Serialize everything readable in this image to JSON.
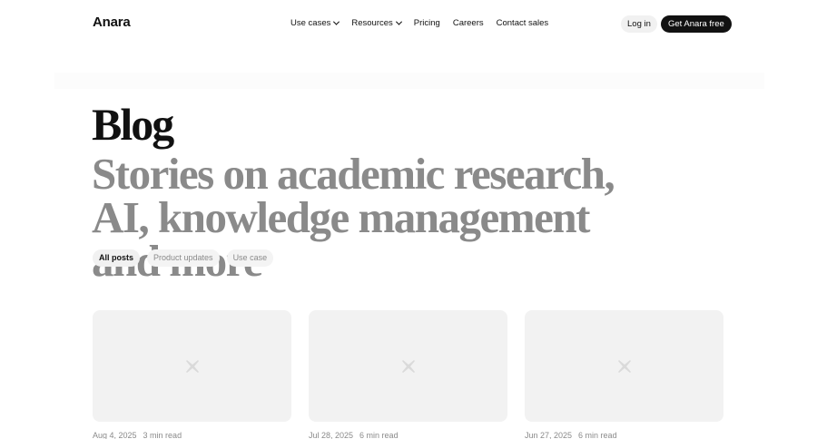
{
  "nav": {
    "logo": "Anara",
    "links": [
      {
        "label": "Use cases",
        "dropdown": true
      },
      {
        "label": "Resources",
        "dropdown": true
      },
      {
        "label": "Pricing",
        "dropdown": false
      },
      {
        "label": "Careers",
        "dropdown": false
      },
      {
        "label": "Contact sales",
        "dropdown": false
      }
    ],
    "login_label": "Log in",
    "cta_label": "Get Anara free"
  },
  "hero": {
    "title": "Blog",
    "subtitle": "Stories on academic research, AI, knowledge management and more"
  },
  "filters": [
    {
      "label": "All posts",
      "active": true
    },
    {
      "label": "Product updates",
      "active": false
    },
    {
      "label": "Use case",
      "active": false
    }
  ],
  "posts": [
    {
      "date": "Aug 4, 2025",
      "read_time": "3 min read",
      "thumb_icon": "broken-image-icon"
    },
    {
      "date": "Jul 28, 2025",
      "read_time": "6 min read",
      "thumb_icon": "broken-image-icon"
    },
    {
      "date": "Jun 27, 2025",
      "read_time": "6 min read",
      "thumb_icon": "broken-image-icon"
    }
  ],
  "colors": {
    "accent": "#111111",
    "muted_text": "#8a8a8a",
    "card_bg": "#f2f2f2"
  }
}
